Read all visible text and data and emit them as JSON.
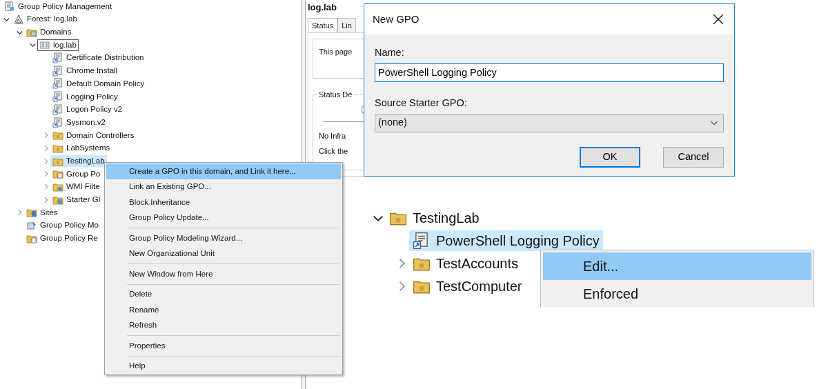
{
  "tree": {
    "title": "Group Policy Management",
    "items": [
      {
        "label": "Forest: log.lab",
        "kind": "forest",
        "expanded": true,
        "selected": false,
        "focused": false,
        "children": [
          {
            "label": "Domains",
            "kind": "domains",
            "expanded": true,
            "selected": false,
            "focused": false,
            "children": [
              {
                "label": "log.lab",
                "kind": "domain",
                "expanded": true,
                "selected": false,
                "focused": true,
                "children": [
                  {
                    "label": "Certificate Distribution",
                    "kind": "gpo-link",
                    "selected": false,
                    "focused": false
                  },
                  {
                    "label": "Chrome Install",
                    "kind": "gpo-link",
                    "selected": false,
                    "focused": false
                  },
                  {
                    "label": "Default Domain Policy",
                    "kind": "gpo-link",
                    "selected": false,
                    "focused": false
                  },
                  {
                    "label": "Logging Policy",
                    "kind": "gpo-link",
                    "selected": false,
                    "focused": false
                  },
                  {
                    "label": "Logon Policy v2",
                    "kind": "gpo-link",
                    "selected": false,
                    "focused": false
                  },
                  {
                    "label": "Sysmon.v2",
                    "kind": "gpo-link",
                    "selected": false,
                    "focused": false
                  },
                  {
                    "label": "Domain Controllers",
                    "kind": "ou",
                    "expanded": false,
                    "selected": false,
                    "focused": false
                  },
                  {
                    "label": "LabSystems",
                    "kind": "ou",
                    "expanded": false,
                    "selected": false,
                    "focused": false
                  },
                  {
                    "label": "TestingLab",
                    "kind": "ou",
                    "expanded": false,
                    "selected": true,
                    "focused": false
                  },
                  {
                    "label": "Group Po",
                    "kind": "gpo-folder",
                    "expanded": false,
                    "selected": false,
                    "focused": false
                  },
                  {
                    "label": "WMI Filte",
                    "kind": "wmi-folder",
                    "expanded": false,
                    "selected": false,
                    "focused": false
                  },
                  {
                    "label": "Starter Gl",
                    "kind": "starter-folder",
                    "expanded": false,
                    "selected": false,
                    "focused": false
                  }
                ]
              }
            ]
          },
          {
            "label": "Sites",
            "kind": "sites",
            "expanded": false,
            "selected": false,
            "focused": false
          },
          {
            "label": "Group Policy Mo",
            "kind": "modeling",
            "selected": false,
            "focused": false
          },
          {
            "label": "Group Policy Re",
            "kind": "results",
            "selected": false,
            "focused": false
          }
        ]
      }
    ]
  },
  "context_menu": {
    "groups": [
      [
        {
          "label": "Create a GPO in this domain, and Link it here...",
          "selected": true
        },
        {
          "label": "Link an Existing GPO...",
          "selected": false
        },
        {
          "label": "Block Inheritance",
          "selected": false
        },
        {
          "label": "Group Policy Update...",
          "selected": false
        }
      ],
      [
        {
          "label": "Group Policy Modeling Wizard...",
          "selected": false
        },
        {
          "label": "New Organizational Unit",
          "selected": false
        }
      ],
      [
        {
          "label": "New Window from Here",
          "selected": false
        }
      ],
      [
        {
          "label": "Delete",
          "selected": false
        },
        {
          "label": "Rename",
          "selected": false
        },
        {
          "label": "Refresh",
          "selected": false
        }
      ],
      [
        {
          "label": "Properties",
          "selected": false
        }
      ],
      [
        {
          "label": "Help",
          "selected": false
        }
      ]
    ]
  },
  "details": {
    "title": "log.lab",
    "tabs": [
      {
        "label": "Status",
        "selected": true
      },
      {
        "label": "Lin",
        "selected": false
      }
    ],
    "intro": "This page",
    "group_title": "Status De",
    "lines": [
      "No Infra",
      "Click the"
    ]
  },
  "dialog": {
    "title": "New GPO",
    "name_label": "Name:",
    "name_value": "PowerShell Logging Policy",
    "source_label": "Source Starter GPO:",
    "source_value": "(none)",
    "buttons": [
      {
        "label": "OK",
        "default": true
      },
      {
        "label": "Cancel",
        "default": false
      }
    ]
  },
  "inset": {
    "items": [
      {
        "label": "TestingLab",
        "kind": "ou",
        "expanded": true,
        "selected": false,
        "focused": false,
        "children": [
          {
            "label": "PowerShell Logging Policy",
            "kind": "gpo-link",
            "selected": true,
            "focused": false
          },
          {
            "label": "TestAccounts",
            "kind": "ou",
            "expanded": false,
            "selected": false,
            "focused": false
          },
          {
            "label": "TestComputer",
            "kind": "ou",
            "expanded": false,
            "selected": false,
            "focused": false
          }
        ]
      }
    ],
    "menu": [
      {
        "label": "Edit...",
        "selected": true
      },
      {
        "label": "Enforced",
        "selected": false
      }
    ]
  }
}
